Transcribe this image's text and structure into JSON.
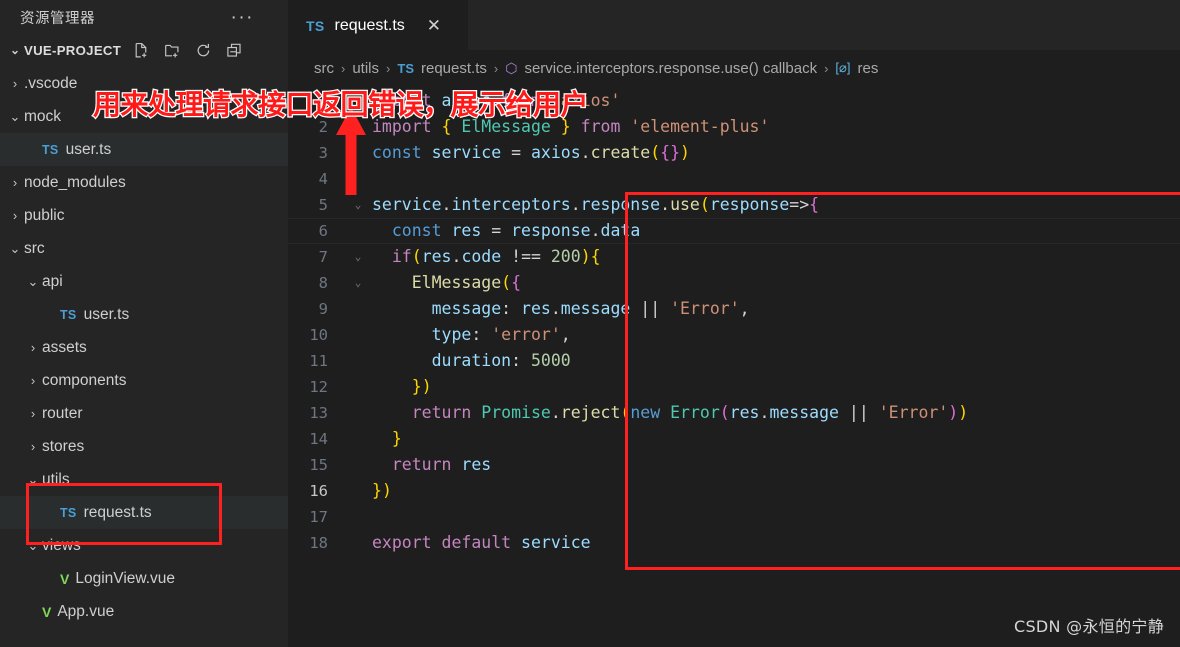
{
  "sidebar": {
    "header_title": "资源管理器",
    "more_actions": "···",
    "root": {
      "label": "VUE-PROJECT",
      "chevron": "⌄",
      "actions": [
        {
          "name": "new-file-icon",
          "label": "New File"
        },
        {
          "name": "new-folder-icon",
          "label": "New Folder"
        },
        {
          "name": "refresh-icon",
          "label": "Refresh Explorer"
        },
        {
          "name": "collapse-folders-icon",
          "label": "Collapse Folders"
        }
      ]
    },
    "items": [
      {
        "label": ".vscode",
        "type": "folder",
        "arrow": "›",
        "indent": 1,
        "selected": false
      },
      {
        "label": "mock",
        "type": "folder",
        "arrow": "⌄",
        "indent": 1,
        "selected": false
      },
      {
        "label": "user.ts",
        "type": "ts",
        "arrow": "",
        "indent": 2,
        "selected": true
      },
      {
        "label": "node_modules",
        "type": "folder",
        "arrow": "›",
        "indent": 1,
        "selected": false
      },
      {
        "label": "public",
        "type": "folder",
        "arrow": "›",
        "indent": 1,
        "selected": false
      },
      {
        "label": "src",
        "type": "folder",
        "arrow": "⌄",
        "indent": 1,
        "selected": false
      },
      {
        "label": "api",
        "type": "folder",
        "arrow": "⌄",
        "indent": 2,
        "selected": false
      },
      {
        "label": "user.ts",
        "type": "ts",
        "arrow": "",
        "indent": 3,
        "selected": false
      },
      {
        "label": "assets",
        "type": "folder",
        "arrow": "›",
        "indent": 2,
        "selected": false
      },
      {
        "label": "components",
        "type": "folder",
        "arrow": "›",
        "indent": 2,
        "selected": false
      },
      {
        "label": "router",
        "type": "folder",
        "arrow": "›",
        "indent": 2,
        "selected": false
      },
      {
        "label": "stores",
        "type": "folder",
        "arrow": "›",
        "indent": 2,
        "selected": false
      },
      {
        "label": "utils",
        "type": "folder",
        "arrow": "⌄",
        "indent": 2,
        "selected": false
      },
      {
        "label": "request.ts",
        "type": "ts",
        "arrow": "",
        "indent": 3,
        "selected": true
      },
      {
        "label": "views",
        "type": "folder",
        "arrow": "⌄",
        "indent": 2,
        "selected": false
      },
      {
        "label": "LoginView.vue",
        "type": "vue",
        "arrow": "",
        "indent": 3,
        "selected": false
      },
      {
        "label": "App.vue",
        "type": "vue",
        "arrow": "",
        "indent": 2,
        "selected": false
      }
    ]
  },
  "tabs": [
    {
      "badge": "TS",
      "label": "request.ts",
      "close": "✕",
      "active": true
    }
  ],
  "breadcrumb": [
    {
      "kind": "text",
      "label": "src"
    },
    {
      "kind": "sep",
      "label": "›"
    },
    {
      "kind": "text",
      "label": "utils"
    },
    {
      "kind": "sep",
      "label": "›"
    },
    {
      "kind": "ts",
      "label": "TS"
    },
    {
      "kind": "text",
      "label": "request.ts"
    },
    {
      "kind": "sep",
      "label": "›"
    },
    {
      "kind": "cube",
      "label": "⬡"
    },
    {
      "kind": "text",
      "label": "service.interceptors.response.use() callback"
    },
    {
      "kind": "sep",
      "label": "›"
    },
    {
      "kind": "field",
      "label": "[⌀]"
    },
    {
      "kind": "text",
      "label": "res"
    }
  ],
  "code": {
    "lines": [
      {
        "num": "1",
        "fold": "",
        "text": "import axios from 'axios'"
      },
      {
        "num": "2",
        "fold": "",
        "text": "import { ElMessage } from 'element-plus'"
      },
      {
        "num": "3",
        "fold": "",
        "text": "const service = axios.create({})"
      },
      {
        "num": "4",
        "fold": "",
        "text": ""
      },
      {
        "num": "5",
        "fold": "⌄",
        "text": "service.interceptors.response.use(response=>{"
      },
      {
        "num": "6",
        "fold": "",
        "text": "  const res = response.data"
      },
      {
        "num": "7",
        "fold": "⌄",
        "text": "  if(res.code !== 200){"
      },
      {
        "num": "8",
        "fold": "⌄",
        "text": "    ElMessage({"
      },
      {
        "num": "9",
        "fold": "",
        "text": "      message: res.message || 'Error',"
      },
      {
        "num": "10",
        "fold": "",
        "text": "      type: 'error',"
      },
      {
        "num": "11",
        "fold": "",
        "text": "      duration: 5000"
      },
      {
        "num": "12",
        "fold": "",
        "text": "    })"
      },
      {
        "num": "13",
        "fold": "",
        "text": "    return Promise.reject(new Error(res.message || 'Error'))"
      },
      {
        "num": "14",
        "fold": "",
        "text": "  }"
      },
      {
        "num": "15",
        "fold": "",
        "text": "  return res"
      },
      {
        "num": "16",
        "fold": "",
        "text": "})"
      },
      {
        "num": "17",
        "fold": "",
        "text": ""
      },
      {
        "num": "18",
        "fold": "",
        "text": "export default service"
      }
    ]
  },
  "annotations": {
    "note_text": "用来处理请求接口返回错误，展示给用户",
    "note_color": "#ff1a1a",
    "box_color": "#ff2020",
    "arrow_color": "#ff2020"
  },
  "watermark": "CSDN @永恒的宁静"
}
